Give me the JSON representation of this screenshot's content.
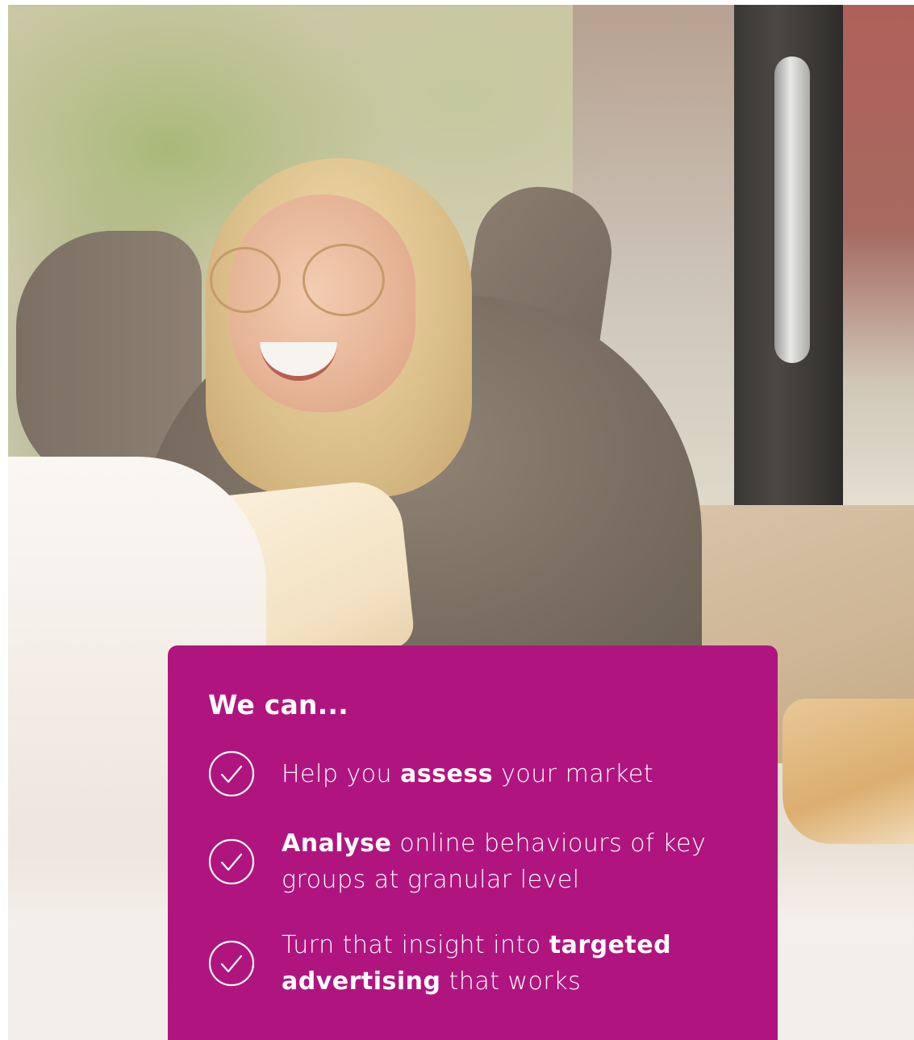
{
  "theme": {
    "card_color": "#b0157f",
    "text_color": "#ffffff"
  },
  "card": {
    "title": "We can...",
    "benefits": [
      {
        "icon": "check-circle-icon",
        "text_1": "Help you ",
        "bold_1": "assess",
        "text_2": " your market"
      },
      {
        "icon": "check-circle-icon",
        "bold_1": "Analyse",
        "text_1": " online behaviours of key groups at granular level"
      },
      {
        "icon": "check-circle-icon",
        "text_1": "Turn that insight into ",
        "bold_1": "targeted advertising",
        "text_2": " that works"
      }
    ]
  }
}
